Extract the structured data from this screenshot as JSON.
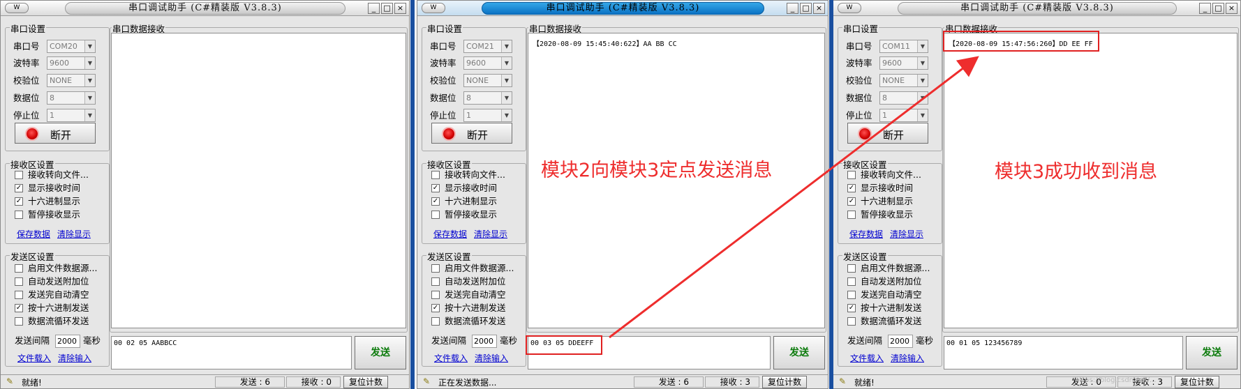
{
  "app_title": "串口调试助手 (C#精装版 V3.8.3)",
  "sys_icon": "W",
  "title_buttons": [
    "_",
    "□",
    "×"
  ],
  "labels": {
    "serial_settings": "串口设置",
    "port": "串口号",
    "baud": "波特率",
    "parity": "校验位",
    "databits": "数据位",
    "stopbits": "停止位",
    "disconnect": "断开",
    "rx_settings": "接收区设置",
    "tx_settings": "发送区设置",
    "rx_panel": "串口数据接收",
    "save_data": "保存数据",
    "clear_display": "清除显示",
    "interval": "发送间隔",
    "ms": "毫秒",
    "file_load": "文件载入",
    "clear_input": "清除输入",
    "send": "发送",
    "reset_count": "复位计数"
  },
  "rx_options": [
    "接收转向文件...",
    "显示接收时间",
    "十六进制显示",
    "暂停接收显示"
  ],
  "tx_options": [
    "启用文件数据源...",
    "自动发送附加位",
    "发送完自动清空",
    "按十六进制发送",
    "数据流循环发送"
  ],
  "windows": [
    {
      "port": "COM20",
      "baud": "9600",
      "parity": "NONE",
      "databits": "8",
      "stopbits": "1",
      "rx_checked": [
        false,
        true,
        true,
        false
      ],
      "tx_checked": [
        false,
        false,
        false,
        true,
        false
      ],
      "interval": "2000",
      "received": "",
      "send_text": "00 02 05 AABBCC",
      "status": "就绪!",
      "sent_count": "发送 : 6",
      "recv_count": "接收 : 0",
      "active": false
    },
    {
      "port": "COM21",
      "baud": "9600",
      "parity": "NONE",
      "databits": "8",
      "stopbits": "1",
      "rx_checked": [
        false,
        true,
        true,
        false
      ],
      "tx_checked": [
        false,
        false,
        false,
        true,
        false
      ],
      "interval": "2000",
      "received": "【2020-08-09 15:45:40:622】AA BB CC",
      "send_text": "00 03 05 DDEEFF",
      "status": "正在发送数据...",
      "sent_count": "发送 : 6",
      "recv_count": "接收 : 3",
      "active": true
    },
    {
      "port": "COM11",
      "baud": "9600",
      "parity": "NONE",
      "databits": "8",
      "stopbits": "1",
      "rx_checked": [
        false,
        true,
        true,
        false
      ],
      "tx_checked": [
        false,
        false,
        false,
        true,
        false
      ],
      "interval": "2000",
      "received": "【2020-08-09 15:47:56:260】DD EE FF",
      "send_text": "00 01 05 123456789",
      "status": "就绪!",
      "sent_count": "发送 : 0",
      "recv_count": "接收 : 3",
      "active": false
    }
  ],
  "annotations": [
    "模块2向模块3定点发送消息",
    "模块3成功收到消息"
  ],
  "watermark": "https://blog.csdn.net/...",
  "colors": {
    "annotation": "#ee2d2d",
    "link": "#0000d0",
    "active_title": "#1a8ad8"
  }
}
